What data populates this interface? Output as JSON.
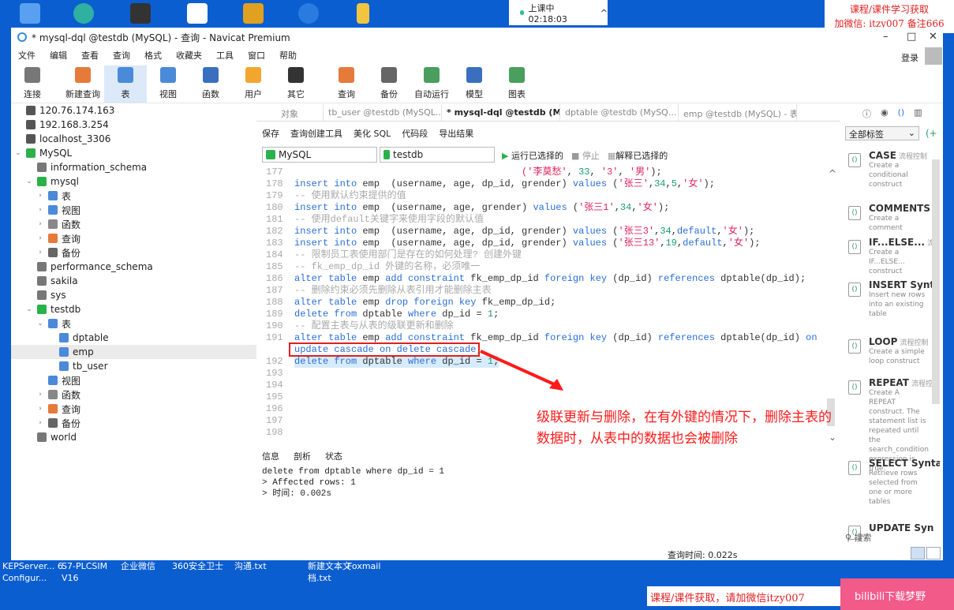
{
  "desktop": {
    "live_status": "上课中 02:18:03",
    "watermark_top": [
      "课程/课件学习获取",
      "加微信: itzy007 备注666"
    ],
    "watermark_bottom": "课程/课件获取，请加微信itzy007",
    "pink_badge": "bilibili下载梦野",
    "icons": [
      "KEPServer... 6 Configur...",
      "S7-PLCSIM V16",
      "企业微信",
      "360安全卫士",
      "沟通.txt",
      "新建文本文档.txt",
      "Foxmail"
    ]
  },
  "window": {
    "title": "* mysql-dql @testdb (MySQL) - 查询 - Navicat Premium",
    "login": "登录"
  },
  "menu": [
    "文件",
    "编辑",
    "查看",
    "查询",
    "格式",
    "收藏夹",
    "工具",
    "窗口",
    "帮助"
  ],
  "toolbar": [
    {
      "label": "连接",
      "color": "#777"
    },
    {
      "label": "新建查询",
      "color": "#e57a3a"
    },
    {
      "label": "表",
      "color": "#4a8ad8",
      "active": true
    },
    {
      "label": "视图",
      "color": "#4a8ad8"
    },
    {
      "label": "函数",
      "color": "#3a6fc0"
    },
    {
      "label": "用户",
      "color": "#f2a630"
    },
    {
      "label": "其它",
      "color": "#333"
    },
    {
      "label": "查询",
      "color": "#e57a3a"
    },
    {
      "label": "备份",
      "color": "#666"
    },
    {
      "label": "自动运行",
      "color": "#4a9e5e"
    },
    {
      "label": "模型",
      "color": "#3a6fc0"
    },
    {
      "label": "图表",
      "color": "#4a9e5e"
    }
  ],
  "sidebar": [
    {
      "label": "120.76.174.163",
      "level": 0,
      "chev": "",
      "icon": "#555"
    },
    {
      "label": "192.168.3.254",
      "level": 0,
      "chev": "",
      "icon": "#555"
    },
    {
      "label": "localhost_3306",
      "level": 0,
      "chev": "",
      "icon": "#555"
    },
    {
      "label": "MySQL",
      "level": 0,
      "chev": "v",
      "icon": "#2bb14a"
    },
    {
      "label": "information_schema",
      "level": 1,
      "chev": "",
      "icon": "#777"
    },
    {
      "label": "mysql",
      "level": 1,
      "chev": "v",
      "icon": "#2bb14a"
    },
    {
      "label": "表",
      "level": 2,
      "chev": ">",
      "icon": "#4a8ad8"
    },
    {
      "label": "视图",
      "level": 2,
      "chev": ">",
      "icon": "#4a8ad8"
    },
    {
      "label": "函数",
      "level": 2,
      "chev": ">",
      "icon": "#888"
    },
    {
      "label": "查询",
      "level": 2,
      "chev": ">",
      "icon": "#e57a3a"
    },
    {
      "label": "备份",
      "level": 2,
      "chev": ">",
      "icon": "#666"
    },
    {
      "label": "performance_schema",
      "level": 1,
      "chev": "",
      "icon": "#777"
    },
    {
      "label": "sakila",
      "level": 1,
      "chev": "",
      "icon": "#777"
    },
    {
      "label": "sys",
      "level": 1,
      "chev": "",
      "icon": "#777"
    },
    {
      "label": "testdb",
      "level": 1,
      "chev": "v",
      "icon": "#2bb14a"
    },
    {
      "label": "表",
      "level": 2,
      "chev": "v",
      "icon": "#4a8ad8"
    },
    {
      "label": "dptable",
      "level": 3,
      "chev": "",
      "icon": "#4a8ad8"
    },
    {
      "label": "emp",
      "level": 3,
      "chev": "",
      "icon": "#4a8ad8",
      "selected": true
    },
    {
      "label": "tb_user",
      "level": 3,
      "chev": "",
      "icon": "#4a8ad8"
    },
    {
      "label": "视图",
      "level": 2,
      "chev": "",
      "icon": "#4a8ad8"
    },
    {
      "label": "函数",
      "level": 2,
      "chev": ">",
      "icon": "#888"
    },
    {
      "label": "查询",
      "level": 2,
      "chev": ">",
      "icon": "#e57a3a"
    },
    {
      "label": "备份",
      "level": 2,
      "chev": ">",
      "icon": "#666"
    },
    {
      "label": "world",
      "level": 1,
      "chev": "",
      "icon": "#777"
    }
  ],
  "tabs": [
    {
      "label": "对象"
    },
    {
      "label": "tb_user @testdb (MySQL..."
    },
    {
      "label": "* mysql-dql @testdb (My...",
      "active": true
    },
    {
      "label": "dptable @testdb (MySQ..."
    },
    {
      "label": "emp @testdb (MySQL) - 表"
    }
  ],
  "query_toolbar": [
    "保存",
    "查询创建工具",
    "美化 SQL",
    "代码段",
    "导出结果"
  ],
  "connection": "MySQL",
  "database": "testdb",
  "run_selected": "运行已选择的",
  "stop": "停止",
  "explain_selected": "解释已选择的",
  "code": [
    {
      "n": "177",
      "s": [
        [
          "id",
          "                                        "
        ],
        [
          "st",
          "('李莫愁'"
        ],
        [
          "id",
          ", "
        ],
        [
          "nm",
          "33"
        ],
        [
          "id",
          ", "
        ],
        [
          "st",
          "'3'"
        ],
        [
          "id",
          ", "
        ],
        [
          "st",
          "'男'"
        ],
        [
          "id",
          ");"
        ]
      ]
    },
    {
      "n": "178",
      "s": [
        [
          "kw",
          "insert into"
        ],
        [
          "id",
          " emp  (username, age, dp_id, grender) "
        ],
        [
          "kw",
          "values"
        ],
        [
          "id",
          " ("
        ],
        [
          "st",
          "'张三'"
        ],
        [
          "id",
          ","
        ],
        [
          "nm",
          "34"
        ],
        [
          "id",
          ","
        ],
        [
          "nm",
          "5"
        ],
        [
          "id",
          ","
        ],
        [
          "st",
          "'女'"
        ],
        [
          "id",
          ");"
        ]
      ]
    },
    {
      "n": "179",
      "s": [
        [
          "cm",
          "-- 使用默认约束提供的值"
        ]
      ]
    },
    {
      "n": "180",
      "s": [
        [
          "kw",
          "insert into"
        ],
        [
          "id",
          " emp  (username, age, grender) "
        ],
        [
          "kw",
          "values"
        ],
        [
          "id",
          " ("
        ],
        [
          "st",
          "'张三1'"
        ],
        [
          "id",
          ","
        ],
        [
          "nm",
          "34"
        ],
        [
          "id",
          ","
        ],
        [
          "st",
          "'女'"
        ],
        [
          "id",
          ");"
        ]
      ]
    },
    {
      "n": "181",
      "s": [
        [
          "cm",
          "-- 使用default关键字来使用字段的默认值"
        ]
      ]
    },
    {
      "n": "182",
      "s": [
        [
          "kw",
          "insert into"
        ],
        [
          "id",
          " emp  (username, age, dp_id, grender) "
        ],
        [
          "kw",
          "values"
        ],
        [
          "id",
          " ("
        ],
        [
          "st",
          "'张三3'"
        ],
        [
          "id",
          ","
        ],
        [
          "nm",
          "34"
        ],
        [
          "id",
          ","
        ],
        [
          "kw",
          "default"
        ],
        [
          "id",
          ","
        ],
        [
          "st",
          "'女'"
        ],
        [
          "id",
          ");"
        ]
      ]
    },
    {
      "n": "183",
      "s": [
        [
          "kw",
          "insert into"
        ],
        [
          "id",
          " emp  (username, age, dp_id, grender) "
        ],
        [
          "kw",
          "values"
        ],
        [
          "id",
          " ("
        ],
        [
          "st",
          "'张三13'"
        ],
        [
          "id",
          ","
        ],
        [
          "nm",
          "19"
        ],
        [
          "id",
          ","
        ],
        [
          "kw",
          "default"
        ],
        [
          "id",
          ","
        ],
        [
          "st",
          "'女'"
        ],
        [
          "id",
          ");"
        ]
      ]
    },
    {
      "n": "184",
      "s": [
        [
          "cm",
          "-- 限制员工表使用部门是存在的如何处理? 创建外键"
        ]
      ]
    },
    {
      "n": "185",
      "s": [
        [
          "cm",
          "-- fk_emp_dp_id 外键的名称，必须唯一"
        ]
      ]
    },
    {
      "n": "186",
      "s": [
        [
          "kw",
          "alter table"
        ],
        [
          "id",
          " emp "
        ],
        [
          "kw",
          "add constraint"
        ],
        [
          "id",
          " fk_emp_dp_id "
        ],
        [
          "kw",
          "foreign key"
        ],
        [
          "id",
          " (dp_id) "
        ],
        [
          "kw",
          "references"
        ],
        [
          "id",
          " dptable(dp_id);"
        ]
      ]
    },
    {
      "n": "187",
      "s": [
        [
          "cm",
          "-- 删除约束必须先删除从表引用才能删除主表"
        ]
      ]
    },
    {
      "n": "188",
      "s": [
        [
          "kw",
          "alter table"
        ],
        [
          "id",
          " emp "
        ],
        [
          "kw",
          "drop foreign key"
        ],
        [
          "id",
          " fk_emp_dp_id;"
        ]
      ]
    },
    {
      "n": "189",
      "s": [
        [
          "kw",
          "delete from"
        ],
        [
          "id",
          " dptable "
        ],
        [
          "kw",
          "where"
        ],
        [
          "id",
          " dp_id = "
        ],
        [
          "nm",
          "1"
        ],
        [
          "id",
          ";"
        ]
      ]
    },
    {
      "n": "190",
      "s": [
        [
          "cm",
          "-- 配置主表与从表的级联更新和删除"
        ]
      ]
    },
    {
      "n": "191",
      "s": [
        [
          "kw",
          "alter table"
        ],
        [
          "id",
          " emp "
        ],
        [
          "kw",
          "add constraint"
        ],
        [
          "id",
          " fk_emp_dp_id "
        ],
        [
          "kw",
          "foreign key"
        ],
        [
          "id",
          " (dp_id) "
        ],
        [
          "kw",
          "references"
        ],
        [
          "id",
          " dptable(dp_id) "
        ],
        [
          "kw",
          "on"
        ]
      ]
    },
    {
      "n": "",
      "s": [
        [
          "kw",
          "update cascade on delete cascade"
        ],
        [
          "id",
          ";"
        ]
      ]
    },
    {
      "n": "192",
      "hl": true,
      "s": [
        [
          "kw",
          "delete from"
        ],
        [
          "id",
          " dptable "
        ],
        [
          "kw",
          "where"
        ],
        [
          "id",
          " dp_id = "
        ],
        [
          "nm",
          "1"
        ],
        [
          "id",
          ";"
        ]
      ]
    },
    {
      "n": "193",
      "s": []
    },
    {
      "n": "194",
      "s": []
    },
    {
      "n": "195",
      "s": []
    },
    {
      "n": "196",
      "s": []
    },
    {
      "n": "197",
      "s": []
    },
    {
      "n": "198",
      "s": []
    }
  ],
  "annotation": "级联更新与删除，在有外键的情况下，删除主表的数据时，从表中的数据也会被删除",
  "bottom_tabs": [
    "信息",
    "剖析",
    "状态"
  ],
  "messages": [
    "delete from dptable where dp_id = 1",
    "> Affected rows: 1",
    "> 时间: 0.002s"
  ],
  "status": "查询时间: 0.022s",
  "right_panel": {
    "filter": "全部标签",
    "search": "搜索",
    "snippets": [
      {
        "name": "CASE",
        "tag": "流程控制",
        "desc": "Create a conditional construct"
      },
      {
        "name": "COMMENTS",
        "tag": "",
        "desc": "Create a comment"
      },
      {
        "name": "IF...ELSE...",
        "tag": "流程",
        "desc": "Create a IF...ELSE... construct"
      },
      {
        "name": "INSERT Synta",
        "tag": "",
        "desc": "Insert new rows into an existing table"
      },
      {
        "name": "LOOP",
        "tag": "流程控制",
        "desc": "Create a simple loop construct"
      },
      {
        "name": "REPEAT",
        "tag": "流程控",
        "desc": "Create A REPEAT construct. The statement list is repeated until the search_condition expression is true."
      },
      {
        "name": "SELECT Synta",
        "tag": "",
        "desc": "Retrieve rows selected from one or more tables"
      },
      {
        "name": "UPDATE Syn",
        "tag": "",
        "desc": ""
      }
    ]
  }
}
